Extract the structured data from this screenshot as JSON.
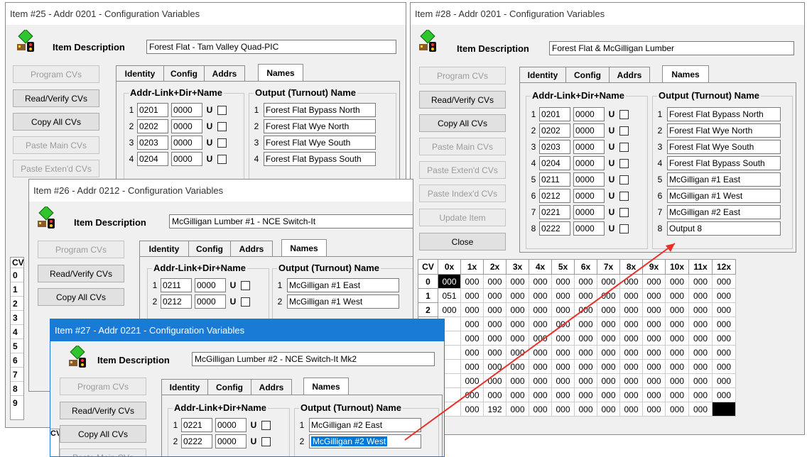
{
  "common": {
    "item_description_label": "Item Description",
    "tabs": [
      "Identity",
      "Config",
      "Addrs",
      "Names"
    ],
    "group_addr": "Addr-Link+Dir+Name",
    "group_output": "Output (Turnout) Name",
    "buttons": {
      "program": "Program CVs",
      "read_verify": "Read/Verify CVs",
      "copy_all": "Copy All CVs",
      "paste_main": "Paste Main CVs",
      "paste_extend": "Paste Exten'd CVs",
      "paste_index": "Paste Index'd CVs",
      "update": "Update Item",
      "close": "Close"
    }
  },
  "windows": {
    "w25": {
      "title": "Item #25 - Addr 0201 - Configuration Variables",
      "description": "Forest Flat - Tam Valley Quad-PIC",
      "rows": [
        {
          "n": "1",
          "addr": "0201",
          "link": "0000",
          "dir": "U",
          "out_n": "1",
          "name": "Forest Flat Bypass North"
        },
        {
          "n": "2",
          "addr": "0202",
          "link": "0000",
          "dir": "U",
          "out_n": "2",
          "name": "Forest Flat Wye North"
        },
        {
          "n": "3",
          "addr": "0203",
          "link": "0000",
          "dir": "U",
          "out_n": "3",
          "name": "Forest Flat Wye South"
        },
        {
          "n": "4",
          "addr": "0204",
          "link": "0000",
          "dir": "U",
          "out_n": "4",
          "name": "Forest Flat Bypass South"
        }
      ],
      "cv_col_label": "CV",
      "cv_rows": [
        "0",
        "1",
        "2",
        "3",
        "4",
        "5",
        "6",
        "7",
        "8",
        "9"
      ]
    },
    "w26": {
      "title": "Item #26 - Addr 0212 - Configuration Variables",
      "description": "McGilligan Lumber #1 - NCE Switch-It",
      "rows": [
        {
          "n": "1",
          "addr": "0211",
          "link": "0000",
          "dir": "U",
          "out_n": "1",
          "name": "McGilligan #1 East"
        },
        {
          "n": "2",
          "addr": "0212",
          "link": "0000",
          "dir": "U",
          "out_n": "2",
          "name": "McGilligan #1 West"
        }
      ]
    },
    "w27": {
      "title": "Item #27 - Addr 0221 - Configuration Variables",
      "description": "McGilligan Lumber #2 - NCE Switch-It Mk2",
      "rows": [
        {
          "n": "1",
          "addr": "0221",
          "link": "0000",
          "dir": "U",
          "out_n": "1",
          "name": "McGilligan #2 East"
        },
        {
          "n": "2",
          "addr": "0222",
          "link": "0000",
          "dir": "U",
          "out_n": "2",
          "name": "McGilligan #2 West"
        }
      ],
      "cv_col_label": "CV"
    },
    "w28": {
      "title": "Item #28 - Addr 0201 - Configuration Variables",
      "description": "Forest Flat & McGilligan Lumber",
      "rows": [
        {
          "n": "1",
          "addr": "0201",
          "link": "0000",
          "dir": "U",
          "out_n": "1",
          "name": "Forest Flat Bypass North"
        },
        {
          "n": "2",
          "addr": "0202",
          "link": "0000",
          "dir": "U",
          "out_n": "2",
          "name": "Forest Flat Wye North"
        },
        {
          "n": "3",
          "addr": "0203",
          "link": "0000",
          "dir": "U",
          "out_n": "3",
          "name": "Forest Flat Wye South"
        },
        {
          "n": "4",
          "addr": "0204",
          "link": "0000",
          "dir": "U",
          "out_n": "4",
          "name": "Forest Flat Bypass South"
        },
        {
          "n": "5",
          "addr": "0211",
          "link": "0000",
          "dir": "U",
          "out_n": "5",
          "name": "McGilligan #1 East"
        },
        {
          "n": "6",
          "addr": "0212",
          "link": "0000",
          "dir": "U",
          "out_n": "6",
          "name": "McGilligan #1 West"
        },
        {
          "n": "7",
          "addr": "0221",
          "link": "0000",
          "dir": "U",
          "out_n": "7",
          "name": "McGilligan #2 East"
        },
        {
          "n": "8",
          "addr": "0222",
          "link": "0000",
          "dir": "U",
          "out_n": "8",
          "name": "Output 8"
        }
      ],
      "cv_table": {
        "corner": "CV",
        "cols": [
          "0x",
          "1x",
          "2x",
          "3x",
          "4x",
          "5x",
          "6x",
          "7x",
          "8x",
          "9x",
          "10x",
          "11x",
          "12x"
        ],
        "rows": [
          {
            "label": "0",
            "values": [
              "000",
              "000",
              "000",
              "000",
              "000",
              "000",
              "000",
              "000",
              "000",
              "000",
              "000",
              "000",
              "000"
            ]
          },
          {
            "label": "1",
            "values": [
              "051",
              "000",
              "000",
              "000",
              "000",
              "000",
              "000",
              "000",
              "000",
              "000",
              "000",
              "000",
              "000"
            ]
          },
          {
            "label": "2",
            "values": [
              "000",
              "000",
              "000",
              "000",
              "000",
              "000",
              "000",
              "000",
              "000",
              "000",
              "000",
              "000",
              "000"
            ]
          },
          {
            "label": "",
            "values": [
              "",
              "000",
              "000",
              "000",
              "000",
              "000",
              "000",
              "000",
              "000",
              "000",
              "000",
              "000",
              "000"
            ]
          },
          {
            "label": "",
            "values": [
              "",
              "000",
              "000",
              "000",
              "000",
              "000",
              "000",
              "000",
              "000",
              "000",
              "000",
              "000",
              "000"
            ]
          },
          {
            "label": "",
            "values": [
              "",
              "000",
              "000",
              "000",
              "000",
              "000",
              "000",
              "000",
              "000",
              "000",
              "000",
              "000",
              "000"
            ]
          },
          {
            "label": "",
            "values": [
              "",
              "000",
              "000",
              "000",
              "000",
              "000",
              "000",
              "000",
              "000",
              "000",
              "000",
              "000",
              "000"
            ]
          },
          {
            "label": "",
            "values": [
              "",
              "000",
              "000",
              "000",
              "000",
              "000",
              "000",
              "000",
              "000",
              "000",
              "000",
              "000",
              "000"
            ]
          },
          {
            "label": "",
            "values": [
              "",
              "000",
              "000",
              "000",
              "000",
              "000",
              "000",
              "000",
              "000",
              "000",
              "000",
              "000",
              "000"
            ]
          },
          {
            "label": "",
            "values": [
              "",
              "000",
              "192",
              "000",
              "000",
              "000",
              "000",
              "000",
              "000",
              "000",
              "000",
              "000",
              ""
            ]
          }
        ]
      }
    }
  },
  "colors": {
    "selection": "#0078d7",
    "arrow": "#e8302a",
    "active_title": "#1a7bd6"
  },
  "icons": {
    "item_icon": "signal-train-icon"
  }
}
